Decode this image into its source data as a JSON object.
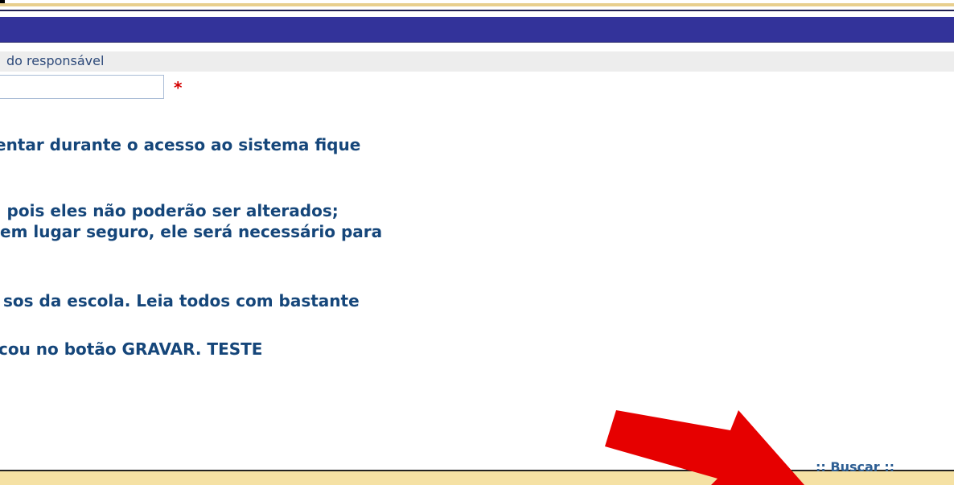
{
  "form": {
    "field_label": "do responsável",
    "input_value": "",
    "required_mark": "*"
  },
  "instructions": [
    "entar durante o acesso ao sistema fique",
    ", pois eles não poderão ser alterados;",
    " em lugar seguro, ele será necessário para",
    "sos da escola. Leia todos com bastante",
    "cou no botão GRAVAR. TESTE"
  ],
  "footer": {
    "search_link": ":: Buscar ::"
  },
  "colors": {
    "title_bar": "#33339a",
    "instruction_text": "#15467a",
    "footer_bar": "#f5e1a4",
    "annotation_arrow": "#e60000"
  }
}
